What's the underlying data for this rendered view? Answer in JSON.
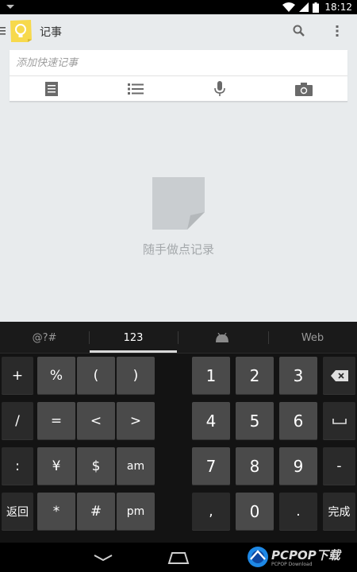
{
  "status_bar": {
    "time": "18:12"
  },
  "app": {
    "title": "记事",
    "quick_note_placeholder": "添加快速记事",
    "empty_text": "随手做点记录",
    "colors": {
      "background": "#e8ebed",
      "logo": "#f7d94c"
    },
    "icons": [
      "menu-icon",
      "keep-logo-icon",
      "search-icon",
      "overflow-menu-icon",
      "text-note-icon",
      "list-note-icon",
      "microphone-icon",
      "camera-icon",
      "empty-note-icon"
    ]
  },
  "keyboard": {
    "tabs": [
      {
        "label": "@?#"
      },
      {
        "label": "123"
      },
      {
        "label": ""
      },
      {
        "label": "Web"
      }
    ],
    "active_tab": "123",
    "rows": [
      [
        "+",
        "%",
        "(",
        ")",
        "1",
        "2",
        "3"
      ],
      [
        "/",
        "=",
        "<",
        ">",
        "4",
        "5",
        "6"
      ],
      [
        ":",
        "¥",
        "$",
        "am",
        "7",
        "8",
        "9",
        "-"
      ],
      [
        "返回",
        "*",
        "#",
        "pm",
        ",",
        "0",
        ".",
        "完成"
      ]
    ]
  },
  "watermark": {
    "brand": "PCPOP下载",
    "sub": "PCPOP Download"
  }
}
